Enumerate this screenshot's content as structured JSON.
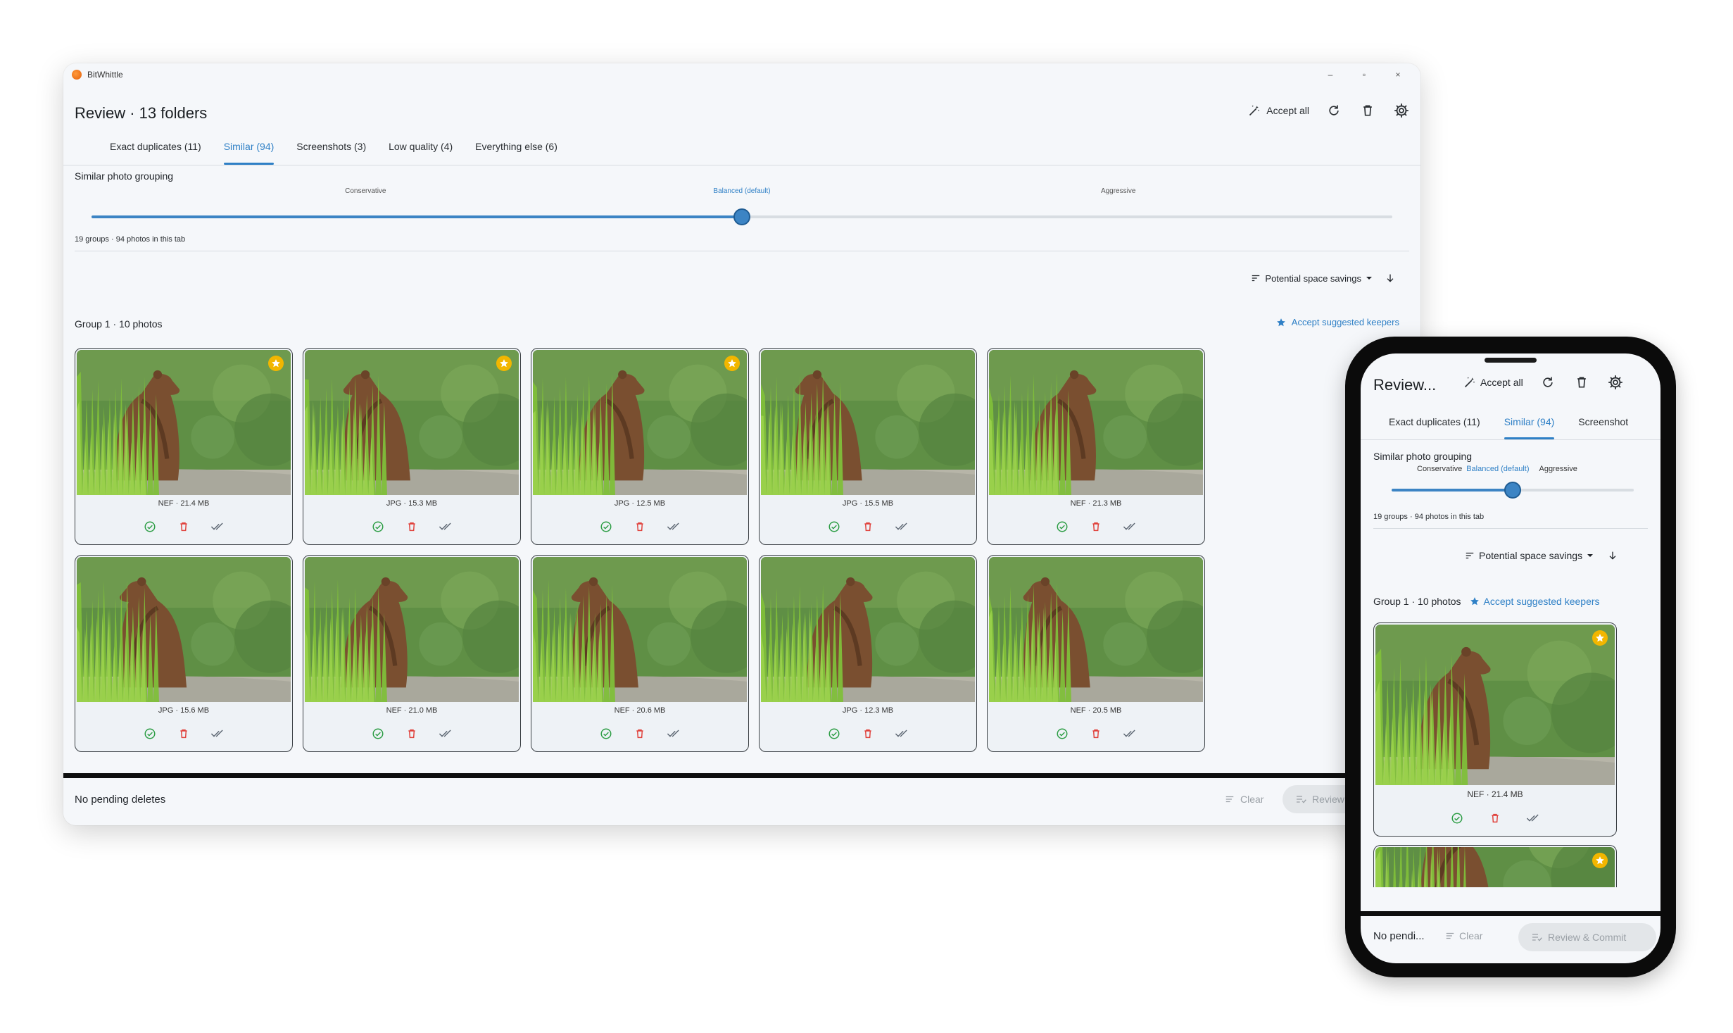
{
  "window": {
    "app_name": "BitWhittle",
    "controls": {
      "minimize": "–",
      "maximize": "▫",
      "close": "×"
    }
  },
  "header": {
    "title": "Review · 13 folders",
    "accept_all_label": "Accept all",
    "icons": [
      "magic-wand-icon",
      "refresh-icon",
      "trash-icon",
      "gear-icon"
    ]
  },
  "tabs": [
    {
      "label": "Exact duplicates (11)",
      "active": false
    },
    {
      "label": "Similar (94)",
      "active": true
    },
    {
      "label": "Screenshots (3)",
      "active": false
    },
    {
      "label": "Low quality (4)",
      "active": false
    },
    {
      "label": "Everything else (6)",
      "active": false
    }
  ],
  "grouping": {
    "title": "Similar photo grouping",
    "levels": [
      "Conservative",
      "Balanced (default)",
      "Aggressive"
    ],
    "selected_index": 1,
    "slider_fraction": 0.5,
    "counts": "19 groups · 94 photos in this tab"
  },
  "sort": {
    "label": "Potential space savings",
    "direction_icon": "arrow-down-icon"
  },
  "group": {
    "title": "Group 1 · 10 photos",
    "accept_keepers_label": "Accept suggested keepers"
  },
  "photos": [
    {
      "meta": "NEF · 21.4 MB",
      "suggested": true
    },
    {
      "meta": "JPG · 15.3 MB",
      "suggested": true
    },
    {
      "meta": "JPG · 12.5 MB",
      "suggested": true
    },
    {
      "meta": "JPG · 15.5 MB",
      "suggested": false
    },
    {
      "meta": "NEF · 21.3 MB",
      "suggested": false
    },
    {
      "meta": "JPG · 15.6 MB",
      "suggested": false
    },
    {
      "meta": "NEF · 21.0 MB",
      "suggested": false
    },
    {
      "meta": "NEF · 20.6 MB",
      "suggested": false
    },
    {
      "meta": "JPG · 12.3 MB",
      "suggested": false
    },
    {
      "meta": "NEF · 20.5 MB",
      "suggested": false
    }
  ],
  "footer": {
    "status": "No pending deletes",
    "clear_label": "Clear",
    "review_label": "Review",
    "review_commit_label": "Review & Commit"
  },
  "mobile": {
    "title": "Review...",
    "footer_status": "No pendi...",
    "tab_truncated": "Screenshot"
  },
  "colors": {
    "accent": "#2f80c6",
    "keep": "#2e9e46",
    "delete": "#e0413b",
    "star": "#f2b600"
  }
}
